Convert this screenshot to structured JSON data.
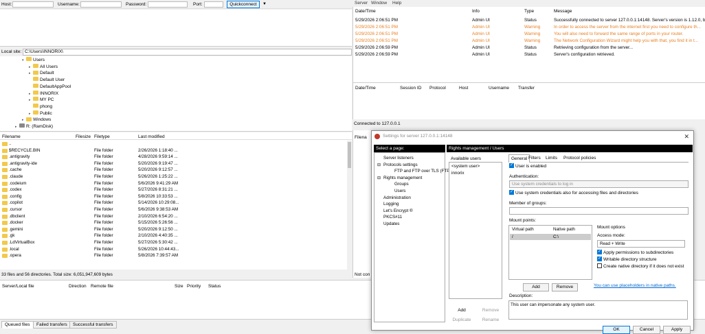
{
  "quickconnect": {
    "host_label": "Host:",
    "username_label": "Username:",
    "password_label": "Password:",
    "port_label": "Port:",
    "button_label": "Quickconnect",
    "dropdown_glyph": "▼"
  },
  "local_site": {
    "label": "Local site:",
    "path": "C:\\Users\\INNORIX\\"
  },
  "tree": [
    {
      "label": "Users",
      "exp": "▾",
      "indent": 0
    },
    {
      "label": "All Users",
      "exp": "▸",
      "indent": 1
    },
    {
      "label": "Default",
      "exp": "▸",
      "indent": 1
    },
    {
      "label": "Default User",
      "exp": "",
      "indent": 1
    },
    {
      "label": "DefaultAppPool",
      "exp": "",
      "indent": 1
    },
    {
      "label": "INNORIX",
      "exp": "▸",
      "indent": 1
    },
    {
      "label": "MY PC",
      "exp": "▸",
      "indent": 1
    },
    {
      "label": "phong",
      "exp": "",
      "indent": 1
    },
    {
      "label": "Public",
      "exp": "▸",
      "indent": 1
    },
    {
      "label": "Windows",
      "exp": "▸",
      "indent": 0
    },
    {
      "label": "R: (RamDisk)",
      "exp": "▸",
      "indent": -1
    }
  ],
  "file_headers": {
    "filename": "Filename",
    "filesize": "Filesize",
    "filetype": "Filetype",
    "modified": "Last modified"
  },
  "files": [
    {
      "name": "..",
      "type": "",
      "date": ""
    },
    {
      "name": "$RECYCLE.BIN",
      "type": "File folder",
      "date": "2/26/2026 1:18:40 ..."
    },
    {
      "name": ".antigravity",
      "type": "File folder",
      "date": "4/28/2026 9:59:14 ..."
    },
    {
      "name": ".antigravity-ide",
      "type": "File folder",
      "date": "5/20/2026 9:19:47 ..."
    },
    {
      "name": ".cache",
      "type": "File folder",
      "date": "5/20/2026 9:12:57 ..."
    },
    {
      "name": ".claude",
      "type": "File folder",
      "date": "5/26/2026 1:25:22 ..."
    },
    {
      "name": ".codeium",
      "type": "File folder",
      "date": "5/6/2026 9:41:29 AM"
    },
    {
      "name": ".codex",
      "type": "File folder",
      "date": "5/27/2026 8:31:21 ..."
    },
    {
      "name": ".config",
      "type": "File folder",
      "date": "5/8/2026 10:33:53 ..."
    },
    {
      "name": ".copilot",
      "type": "File folder",
      "date": "5/14/2026 10:29:08..."
    },
    {
      "name": ".cursor",
      "type": "File folder",
      "date": "5/6/2026 9:38:53 AM"
    },
    {
      "name": ".dbclient",
      "type": "File folder",
      "date": "2/10/2026 6:54:20 ..."
    },
    {
      "name": ".docker",
      "type": "File folder",
      "date": "5/15/2026 5:26:56 ..."
    },
    {
      "name": ".gemini",
      "type": "File folder",
      "date": "5/20/2026 9:12:50 ..."
    },
    {
      "name": ".gk",
      "type": "File folder",
      "date": "2/10/2026 4:40:35 ..."
    },
    {
      "name": ".LdVirtualBox",
      "type": "File folder",
      "date": "5/27/2026 5:30:42 ..."
    },
    {
      "name": ".local",
      "type": "File folder",
      "date": "5/26/2026 10:44:43..."
    },
    {
      "name": ".opera",
      "type": "File folder",
      "date": "5/8/2026 7:39:57 AM"
    }
  ],
  "local_status": "33 files and 56 directories. Total size: 6,051,947,609 bytes",
  "queue_headers": {
    "server": "Server/Local file",
    "direction": "Direction",
    "remote": "Remote file",
    "size": "Size",
    "priority": "Priority",
    "status": "Status"
  },
  "queue_tabs": [
    "Queued files",
    "Failed transfers",
    "Successful transfers"
  ],
  "server_menu": [
    "Server",
    "Window",
    "Help"
  ],
  "log_headers": {
    "date": "Date/Time",
    "info": "Info",
    "type": "Type",
    "message": "Message"
  },
  "log": [
    {
      "date": "5/29/2026 2:06:51 PM",
      "info": "Admin UI",
      "type": "Status",
      "msg": "Successfully connected to server 127.0.0.1:14148. Server's version is 1.12.0, b...",
      "warn": false
    },
    {
      "date": "5/29/2026 2:06:51 PM",
      "info": "Admin UI",
      "type": "Warning",
      "msg": "In order to access the server from the internet first you need to configure th...",
      "warn": true
    },
    {
      "date": "5/29/2026 2:06:51 PM",
      "info": "Admin UI",
      "type": "Warning",
      "msg": "You will also need to forward the same range of ports in your router.",
      "warn": true
    },
    {
      "date": "5/29/2026 2:06:51 PM",
      "info": "Admin UI",
      "type": "Warning",
      "msg": "The Network Configuration Wizard might help you with that, you find it in t...",
      "warn": true
    },
    {
      "date": "5/29/2026 2:06:59 PM",
      "info": "Admin UI",
      "type": "Status",
      "msg": "Retrieving configuration from the server...",
      "warn": false
    },
    {
      "date": "5/29/2026 2:06:59 PM",
      "info": "Admin UI",
      "type": "Status",
      "msg": "Server's configuration retrieved.",
      "warn": false
    }
  ],
  "session_headers": [
    "Date/Time",
    "Session ID",
    "Protocol",
    "Host",
    "Username",
    "Transfer"
  ],
  "server_status": "Connected to 127.0.0.1",
  "right_filename_stub": "Filena",
  "right_notconn_stub": "Not con",
  "dialog": {
    "title": "Settings for server 127.0.0.1:14148",
    "close_glyph": "✕",
    "select_page": "Select a page:",
    "panel_title": "Rights management / Users",
    "pages": [
      {
        "label": "Server listeners",
        "indent": 0,
        "exp": ""
      },
      {
        "label": "Protocols settings",
        "indent": 0,
        "exp": "⊟"
      },
      {
        "label": "FTP and FTP over TLS (FTPS)",
        "indent": 1,
        "exp": ""
      },
      {
        "label": "Rights management",
        "indent": 0,
        "exp": "⊟"
      },
      {
        "label": "Groups",
        "indent": 1,
        "exp": ""
      },
      {
        "label": "Users",
        "indent": 1,
        "exp": ""
      },
      {
        "label": "Administration",
        "indent": 0,
        "exp": ""
      },
      {
        "label": "Logging",
        "indent": 0,
        "exp": ""
      },
      {
        "label": "Let's Encrypt ®",
        "indent": 0,
        "exp": ""
      },
      {
        "label": "PKCS#11",
        "indent": 0,
        "exp": ""
      },
      {
        "label": "Updates",
        "indent": 0,
        "exp": ""
      }
    ],
    "available_users": "Available users",
    "users": [
      "<system user>",
      "innorix"
    ],
    "add": "Add",
    "remove": "Remove",
    "duplicate": "Duplicate",
    "rename": "Rename",
    "tabs": [
      "General",
      "Filters",
      "Limits",
      "Protocol policies"
    ],
    "user_enabled": "User is enabled",
    "authentication": "Authentication:",
    "auth_value": "Use system credentials to log in",
    "use_sys_cred": "Use system credentials also for accessing files and directories",
    "member_groups": "Member of groups:",
    "mount_points": "Mount points:",
    "virtual_path": "Virtual path",
    "native_path": "Native path",
    "mount_virtual": "/",
    "mount_native": "C:\\",
    "mount_options": "Mount options",
    "access_mode": "Access mode:",
    "access_value": "Read + Write",
    "apply_perm": "Apply permissions to subdirectories",
    "writable_dir": "Writable directory structure",
    "create_native": "Create native directory if it does not exist",
    "placeholders_link": "You can use placeholders in native paths.",
    "description": "Description:",
    "desc_text": "This user can impersonate any system user.",
    "ok": "OK",
    "cancel": "Cancel",
    "apply": "Apply"
  }
}
